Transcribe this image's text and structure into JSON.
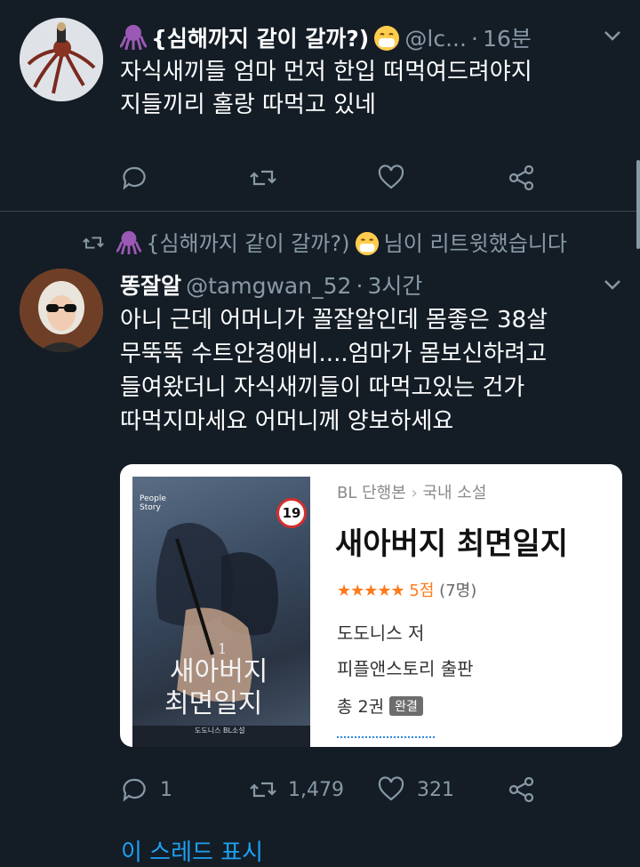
{
  "tweet1": {
    "name": "{심해까지 같이 갈까?)",
    "handle": "@lc...",
    "sep": "·",
    "time": "16분",
    "text_line1": "자식새끼들 엄마 먼저 한입 떠먹여드려야지",
    "text_line2": "지들끼리 홀랑 따먹고 있네"
  },
  "retweet_context": {
    "name": "{심해까지 같이 갈까?)",
    "suffix": "님이 리트윗했습니다"
  },
  "tweet2": {
    "name": "똥잘알",
    "handle": "@tamgwan_52",
    "sep": "·",
    "time": "3시간",
    "lines": [
      "아니 근데 어머니가 꼴잘알인데 몸좋은 38살",
      "무뚝뚝 수트안경애비....엄마가 몸보신하려고",
      "들여왔더니 자식새끼들이 따먹고있는 건가",
      "따먹지마세요 어머니께 양보하세요"
    ],
    "reply_count": "1",
    "retweet_count": "1,479",
    "like_count": "321"
  },
  "book": {
    "category": "BL 단행본",
    "subcategory": "국내 소설",
    "title": "새아버지 최면일지",
    "rating": "5점",
    "rating_count": "(7명)",
    "author": "도도니스 저",
    "publisher": "피플앤스토리 출판",
    "volumes": "총 2권",
    "status_badge": "완결",
    "cover_title_line1": "새아버지",
    "cover_title_line2": "최면일지",
    "cover_number": "1",
    "cover_age": "19",
    "cover_author": "도도니스 BL소설",
    "cover_brand": "People Story"
  },
  "thread_link": "이 스레드 표시",
  "colors": {
    "background": "#141d26",
    "text": "#ffffff",
    "muted": "#8899a6",
    "link": "#1da1f2",
    "octopus": "#9b59b6",
    "star": "#ff7a1a"
  }
}
